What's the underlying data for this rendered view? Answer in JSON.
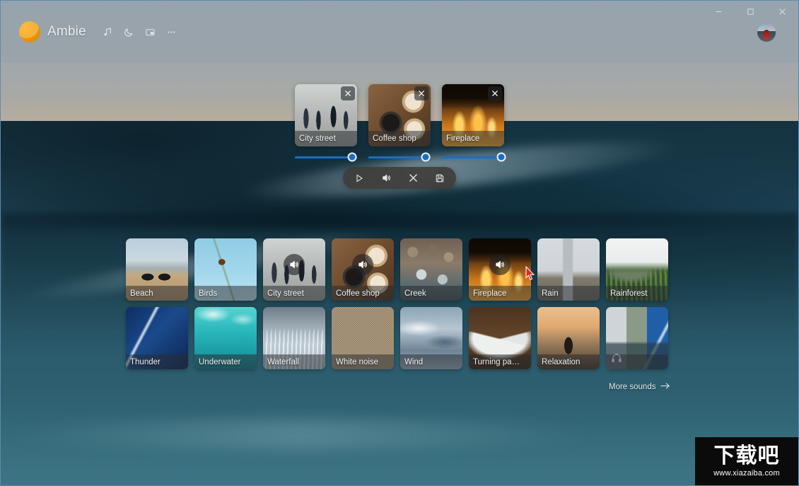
{
  "app": {
    "name": "Ambie",
    "logo_icon": "ambie-sun-logo"
  },
  "titlebar": {
    "icons": [
      {
        "name": "music-note-icon",
        "label": "Music"
      },
      {
        "name": "moon-icon",
        "label": "Sleep timer"
      },
      {
        "name": "compact-mode-icon",
        "label": "Compact mode"
      },
      {
        "name": "more-icon",
        "label": "More"
      }
    ],
    "window_controls": [
      {
        "name": "minimize-button",
        "glyph": "–"
      },
      {
        "name": "maximize-button",
        "glyph": "□"
      },
      {
        "name": "close-button",
        "glyph": "✕"
      }
    ],
    "avatar_label": "User account"
  },
  "active_sounds": [
    {
      "name": "City street",
      "art": "t-city",
      "volume": 92,
      "remove_label": "✕"
    },
    {
      "name": "Coffee shop",
      "art": "t-coffee",
      "volume": 92,
      "remove_label": "✕"
    },
    {
      "name": "Fireplace",
      "art": "t-fire",
      "volume": 95,
      "remove_label": "✕"
    }
  ],
  "playback": {
    "buttons": [
      {
        "name": "play-button",
        "icon": "play-icon"
      },
      {
        "name": "volume-button",
        "icon": "speaker-icon"
      },
      {
        "name": "clear-all-button",
        "icon": "close-icon"
      },
      {
        "name": "save-mix-button",
        "icon": "save-icon"
      }
    ]
  },
  "sound_grid": {
    "rows": [
      [
        {
          "name": "Beach",
          "art": "t-beach",
          "playing": false
        },
        {
          "name": "Birds",
          "art": "t-birds",
          "playing": false
        },
        {
          "name": "City street",
          "art": "t-city",
          "playing": true
        },
        {
          "name": "Coffee shop",
          "art": "t-coffee",
          "playing": true
        },
        {
          "name": "Creek",
          "art": "t-creek",
          "playing": false
        },
        {
          "name": "Fireplace",
          "art": "t-fire",
          "playing": true
        },
        {
          "name": "Rain",
          "art": "t-rain",
          "playing": false
        },
        {
          "name": "Rainforest",
          "art": "t-rainforest",
          "playing": false
        }
      ],
      [
        {
          "name": "Thunder",
          "art": "t-thunder",
          "playing": false
        },
        {
          "name": "Underwater",
          "art": "t-underwater",
          "playing": false
        },
        {
          "name": "Waterfall",
          "art": "t-waterfall",
          "playing": false
        },
        {
          "name": "White noise",
          "art": "t-white",
          "playing": false
        },
        {
          "name": "Wind",
          "art": "t-wind",
          "playing": false
        },
        {
          "name": "Turning pa…",
          "art": "t-book",
          "playing": false
        },
        {
          "name": "Relaxation",
          "art": "t-relax",
          "playing": false
        },
        {
          "name": "",
          "art": "t-mix",
          "playing": false,
          "headphones": true
        }
      ]
    ]
  },
  "more_sounds": {
    "label": "More sounds",
    "arrow": "→"
  },
  "watermark": {
    "cn": "下载吧",
    "url": "www.xiazaiba.com"
  },
  "colors": {
    "accent": "#1b6ec2",
    "logo_orange": "#e8920b",
    "titlebar": "rgba(150,160,168,.55)",
    "playbar": "rgba(62,60,56,.9)"
  }
}
